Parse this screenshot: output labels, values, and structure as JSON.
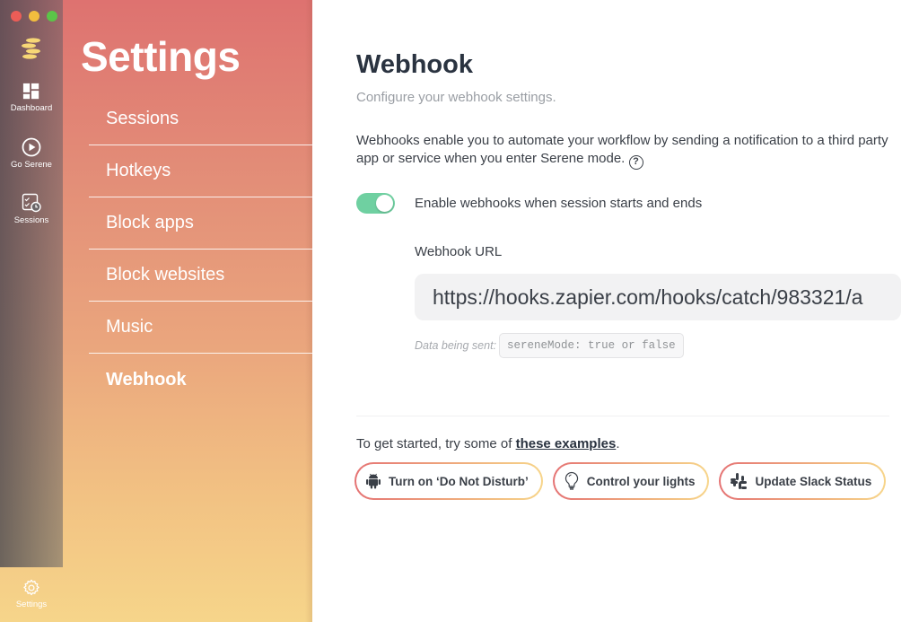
{
  "window": {
    "controls": [
      "close",
      "minimize",
      "maximize"
    ]
  },
  "rail": {
    "logo_icon": "serene-logo-icon",
    "items": [
      {
        "label": "Dashboard",
        "icon": "dashboard-icon"
      },
      {
        "label": "Go Serene",
        "icon": "play-circle-icon"
      },
      {
        "label": "Sessions",
        "icon": "sessions-calendar-icon"
      }
    ],
    "bottom": {
      "label": "Settings",
      "icon": "gear-icon",
      "active": true
    }
  },
  "settings_nav": {
    "title": "Settings",
    "items": [
      {
        "label": "Sessions"
      },
      {
        "label": "Hotkeys"
      },
      {
        "label": "Block apps"
      },
      {
        "label": "Block websites"
      },
      {
        "label": "Music"
      },
      {
        "label": "Webhook",
        "active": true
      }
    ]
  },
  "main": {
    "title": "Webhook",
    "subtitle": "Configure your webhook settings.",
    "description": "Webhooks enable you to automate your workflow by sending a notification to a third party app or service when you enter Serene mode.",
    "help_icon": "?",
    "toggle": {
      "label": "Enable webhooks when session starts and ends",
      "on": true
    },
    "url_label": "Webhook URL",
    "url_value": "https://hooks.zapier.com/hooks/catch/983321/a",
    "data_label": "Data being sent:",
    "data_code": "sereneMode: true or false",
    "examples_prefix": "To get started, try some of ",
    "examples_link": "these examples",
    "examples_suffix": ".",
    "examples": [
      {
        "label": "Turn on ‘Do Not Disturb’",
        "icon": "android-icon"
      },
      {
        "label": "Control your lights",
        "icon": "lightbulb-icon"
      },
      {
        "label": "Update Slack Status",
        "icon": "slack-icon"
      }
    ]
  },
  "colors": {
    "toggle_on": "#6fd0a1",
    "gradient_top": "#de7270",
    "gradient_bottom": "#f6d58a",
    "title_text": "#2a3340"
  }
}
